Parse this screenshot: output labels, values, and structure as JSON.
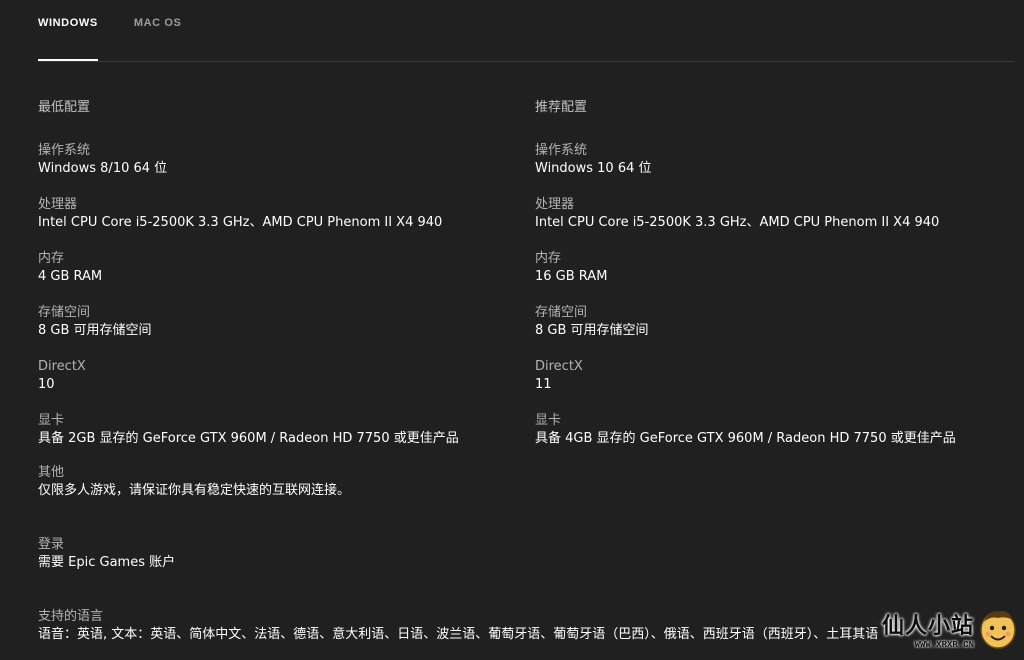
{
  "tabs": [
    {
      "label": "WINDOWS",
      "active": true
    },
    {
      "label": "MAC OS",
      "active": false
    }
  ],
  "minimum": {
    "title": "最低配置",
    "specs": [
      {
        "label": "操作系统",
        "value": "Windows 8/10 64 位"
      },
      {
        "label": "处理器",
        "value": "Intel CPU Core i5-2500K 3.3 GHz、AMD CPU Phenom II X4 940"
      },
      {
        "label": "内存",
        "value": "4 GB RAM"
      },
      {
        "label": "存储空间",
        "value": "8 GB 可用存储空间"
      },
      {
        "label": "DirectX",
        "value": "10"
      },
      {
        "label": "显卡",
        "value": "具备 2GB 显存的 GeForce GTX 960M / Radeon HD 7750 或更佳产品"
      }
    ]
  },
  "recommended": {
    "title": "推荐配置",
    "specs": [
      {
        "label": "操作系统",
        "value": "Windows 10 64 位"
      },
      {
        "label": "处理器",
        "value": "Intel CPU Core i5-2500K 3.3 GHz、AMD CPU Phenom II X4 940"
      },
      {
        "label": "内存",
        "value": "16 GB RAM"
      },
      {
        "label": "存储空间",
        "value": "8 GB 可用存储空间"
      },
      {
        "label": "DirectX",
        "value": "11"
      },
      {
        "label": "显卡",
        "value": "具备 4GB 显存的 GeForce GTX 960M / Radeon HD 7750 或更佳产品"
      }
    ]
  },
  "other": {
    "label": "其他",
    "value": "仅限多人游戏，请保证你具有稳定快速的互联网连接。"
  },
  "login": {
    "label": "登录",
    "value": "需要 Epic Games 账户"
  },
  "languages": {
    "label": "支持的语言",
    "value": "语音：英语, 文本：英语、简体中文、法语、德语、意大利语、日语、波兰语、葡萄牙语、葡萄牙语（巴西）、俄语、西班牙语（西班牙）、土耳其语"
  },
  "watermark": {
    "title": "仙人小站",
    "url": "WWW.XRXR.CN",
    "icon": "mascot-icon"
  },
  "colors": {
    "background": "#202020",
    "text": "#ffffff",
    "divider": "#3a3a3a"
  }
}
